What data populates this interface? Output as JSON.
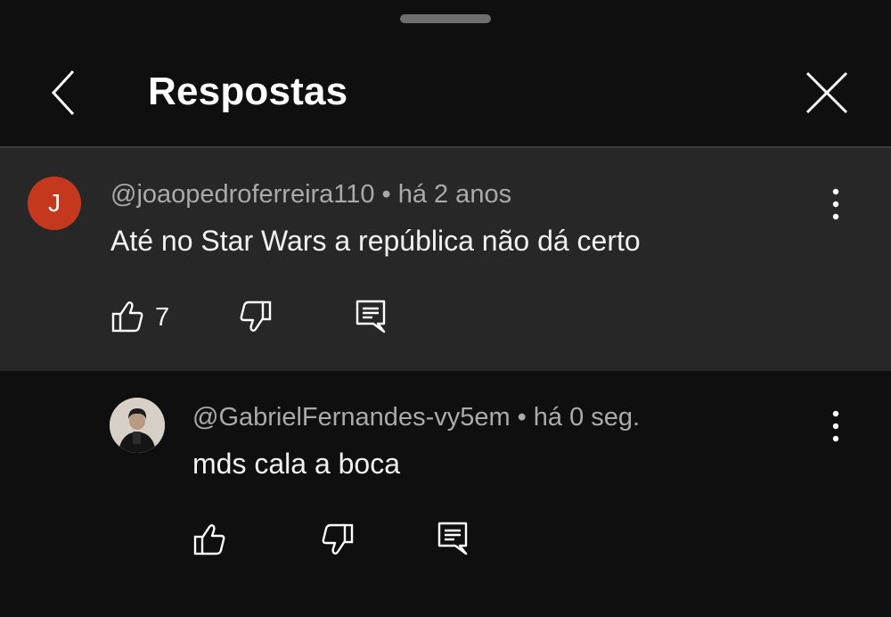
{
  "header": {
    "title": "Respostas",
    "back_icon": "chevron-left-icon",
    "close_icon": "close-icon"
  },
  "parent_comment": {
    "avatar_letter": "J",
    "avatar_color": "#c4391d",
    "author": "@joaopedroferreira110",
    "separator": "•",
    "time": "há 2 anos",
    "text": "Até no Star Wars a república não dá certo",
    "like_count": "7"
  },
  "reply_comment": {
    "author": "@GabrielFernandes-vy5em",
    "separator": "•",
    "time": "há 0 seg.",
    "text": "mds cala a boca"
  },
  "colors": {
    "background": "#0f0f0f",
    "highlight_background": "#272727",
    "secondary_text": "#aaaaaa",
    "primary_text": "#f1f1f1"
  }
}
